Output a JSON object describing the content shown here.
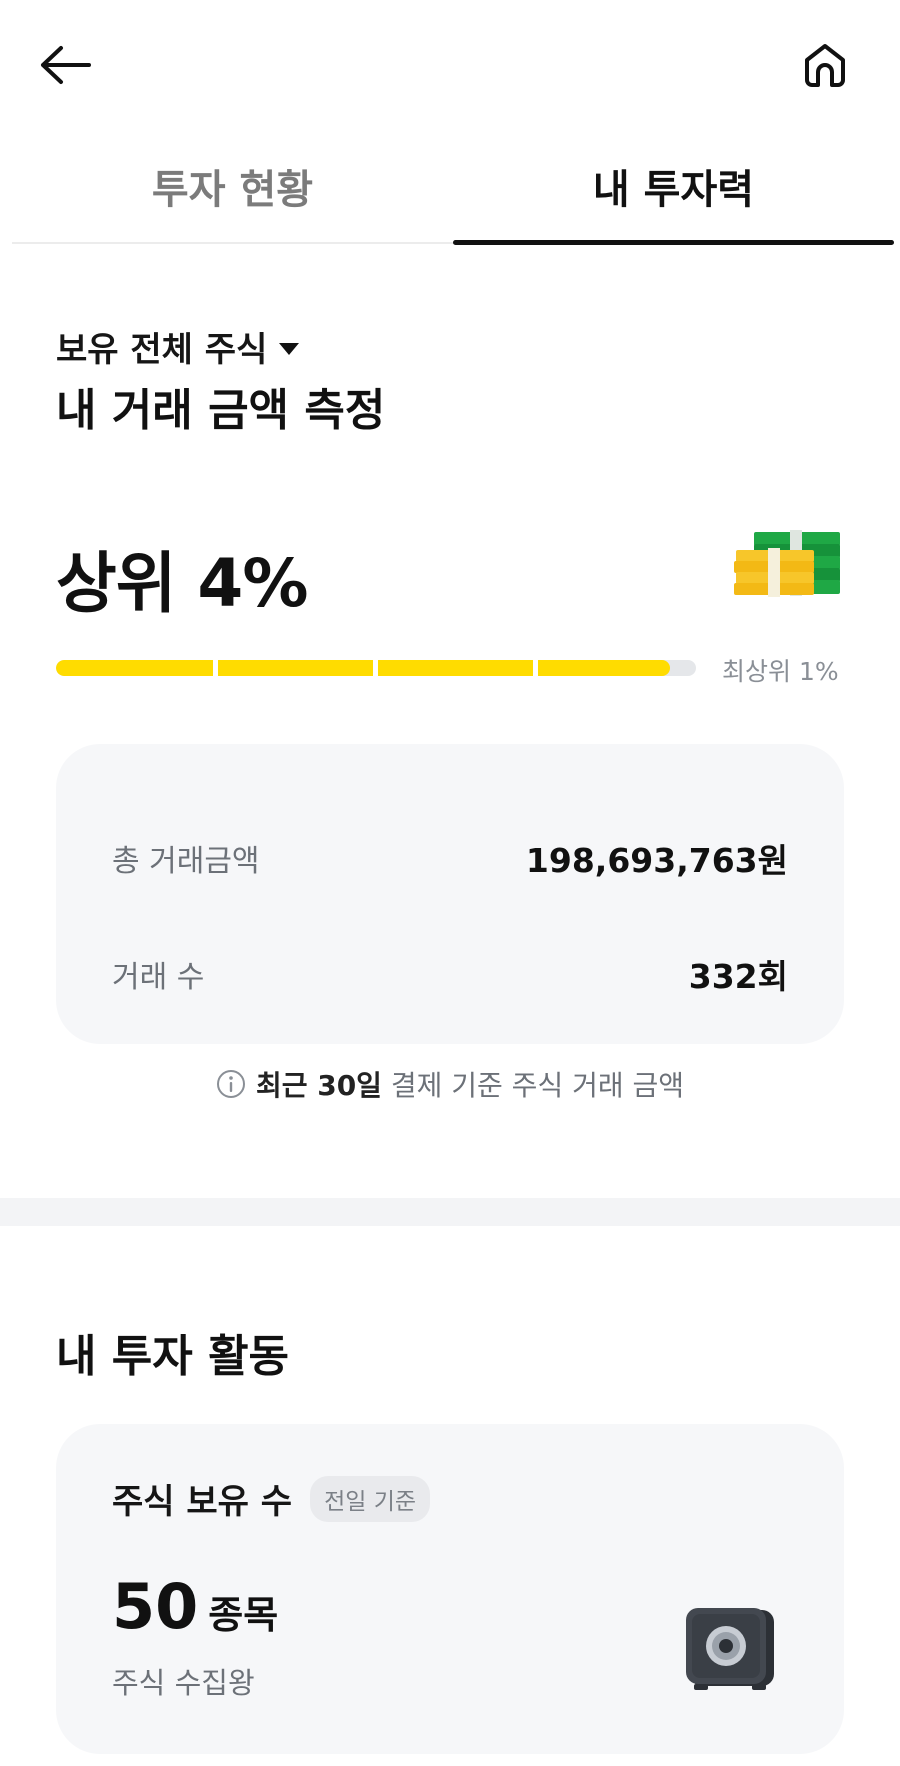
{
  "icons": {
    "back": "arrow-left-icon",
    "home": "home-icon",
    "info": "info-circle-icon",
    "money": "money-stacks-icon",
    "safe": "safe-icon"
  },
  "tabs": [
    {
      "label": "투자 현황",
      "active": false
    },
    {
      "label": "내 투자력",
      "active": true
    }
  ],
  "measure": {
    "scope": "보유 전체 주식",
    "title": "내 거래 금액 측정",
    "rank": "상위 4%",
    "progress_fraction": 0.96,
    "progress_label": "최상위 1%",
    "stats": [
      {
        "label": "총 거래금액",
        "value": "198,693,763원"
      },
      {
        "label": "거래 수",
        "value": "332회"
      }
    ],
    "note_bold": "최근 30일",
    "note_rest": "결제 기준 주식 거래 금액"
  },
  "activity": {
    "title": "내 투자 활동",
    "holding": {
      "title": "주식 보유 수",
      "badge": "전일 기준",
      "count": "50",
      "unit": "종목",
      "subtitle": "주식 수집왕"
    }
  },
  "colors": {
    "accent": "#ffdc00",
    "track": "#e5e7ea",
    "card_bg": "#f6f7f9",
    "text": "#111111",
    "muted": "#6c7178"
  }
}
